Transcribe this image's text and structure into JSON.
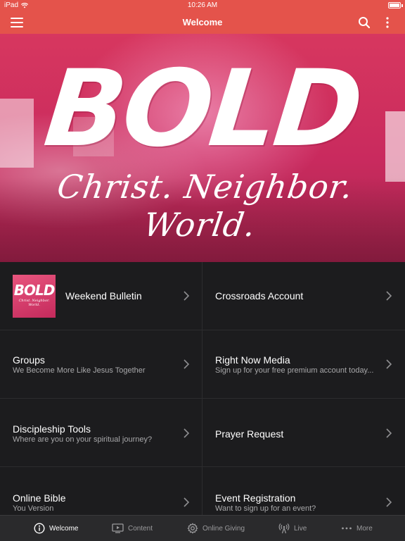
{
  "status_bar": {
    "carrier": "iPad",
    "time": "10:26 AM"
  },
  "nav": {
    "title": "Welcome",
    "icons": [
      "menu-icon",
      "search-icon",
      "more-vertical-icon"
    ]
  },
  "hero": {
    "headline": "BOLD",
    "tagline": "Christ. Neighbor. World."
  },
  "grid": [
    {
      "title": "Weekend Bulletin",
      "subtitle": "",
      "has_thumbnail": true,
      "thumbnail_headline": "BOLD",
      "thumbnail_tagline": "Christ. Neighbor. World."
    },
    {
      "title": "Crossroads Account",
      "subtitle": ""
    },
    {
      "title": "Groups",
      "subtitle": "We Become More Like Jesus Together"
    },
    {
      "title": "Right Now Media",
      "subtitle": "Sign up for your free premium account today..."
    },
    {
      "title": "Discipleship Tools",
      "subtitle": "Where are you on your spiritual journey?"
    },
    {
      "title": "Prayer Request",
      "subtitle": ""
    },
    {
      "title": "Online Bible",
      "subtitle": "You Version"
    },
    {
      "title": "Event Registration",
      "subtitle": "Want to sign up for an event?"
    }
  ],
  "tabs": [
    {
      "label": "Welcome",
      "icon": "info-circle-icon",
      "active": true
    },
    {
      "label": "Content",
      "icon": "tv-play-icon",
      "active": false
    },
    {
      "label": "Online Giving",
      "icon": "gear-icon",
      "active": false
    },
    {
      "label": "Live",
      "icon": "broadcast-icon",
      "active": false
    },
    {
      "label": "More",
      "icon": "ellipsis-icon",
      "active": false
    }
  ],
  "colors": {
    "accent": "#e4534b",
    "background": "#1c1c1e",
    "tab_bar": "#2a2a2c",
    "subtitle_text": "#a8a8aa"
  }
}
